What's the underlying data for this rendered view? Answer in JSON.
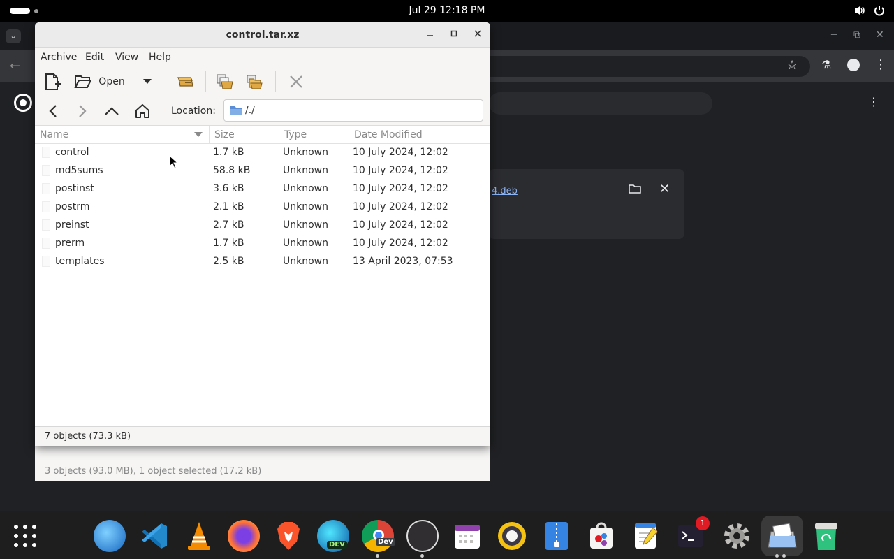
{
  "topbar": {
    "clock": "Jul 29  12:18 PM",
    "icons": [
      "volume-icon",
      "power-icon"
    ]
  },
  "browser": {
    "download_link": "4.deb"
  },
  "window": {
    "title": "control.tar.xz",
    "menu": [
      "Archive",
      "Edit",
      "View",
      "Help"
    ],
    "toolbar": {
      "open_label": "Open"
    },
    "location": {
      "label": "Location:",
      "value": "/./"
    },
    "columns": [
      "Name",
      "Size",
      "Type",
      "Date Modified"
    ],
    "files": [
      {
        "name": "control",
        "size": "1.7 kB",
        "type": "Unknown",
        "modified": "10 July 2024, 12:02"
      },
      {
        "name": "md5sums",
        "size": "58.8 kB",
        "type": "Unknown",
        "modified": "10 July 2024, 12:02"
      },
      {
        "name": "postinst",
        "size": "3.6 kB",
        "type": "Unknown",
        "modified": "10 July 2024, 12:02"
      },
      {
        "name": "postrm",
        "size": "2.1 kB",
        "type": "Unknown",
        "modified": "10 July 2024, 12:02"
      },
      {
        "name": "preinst",
        "size": "2.7 kB",
        "type": "Unknown",
        "modified": "10 July 2024, 12:02"
      },
      {
        "name": "prerm",
        "size": "1.7 kB",
        "type": "Unknown",
        "modified": "10 July 2024, 12:02"
      },
      {
        "name": "templates",
        "size": "2.5 kB",
        "type": "Unknown",
        "modified": "13 April 2023, 07:53"
      }
    ],
    "status": "7 objects (73.3 kB)"
  },
  "back_window": {
    "status": "3 objects (93.0 MB), 1 object selected (17.2 kB)"
  },
  "dock": {
    "badge": "1",
    "apps": [
      "globe-icon",
      "vscode-icon",
      "vlc-icon",
      "firefox-icon",
      "brave-icon",
      "edge-dev-icon",
      "chrome-dev-icon",
      "obs-icon",
      "calendar-icon",
      "speaker-icon",
      "archive-icon",
      "software-icon",
      "text-editor-icon",
      "terminal-icon",
      "settings-icon",
      "file-roller-icon",
      "trash-icon"
    ],
    "dev_label": "Dev",
    "edge_label": "DEV"
  }
}
